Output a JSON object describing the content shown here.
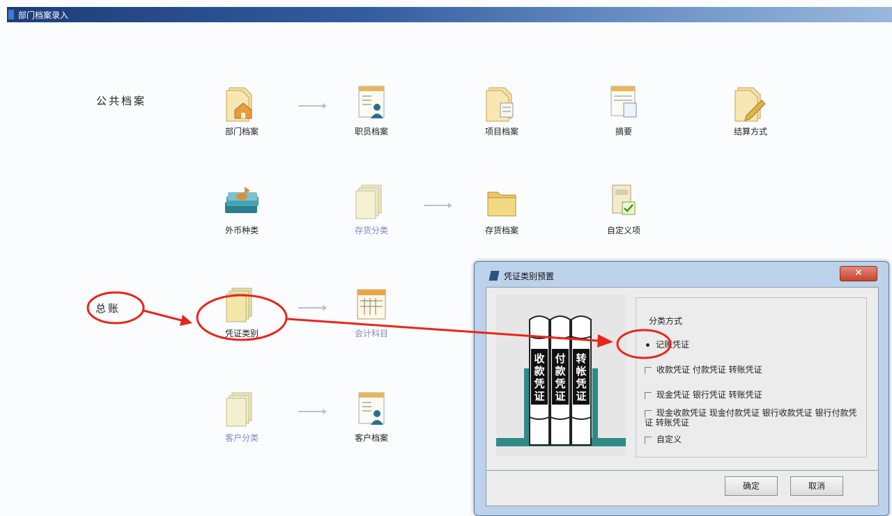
{
  "window": {
    "title": "部门档案录入"
  },
  "sections": {
    "public": "公共档案",
    "ledger": "总账"
  },
  "items": {
    "dept": "部门档案",
    "staff": "职员档案",
    "project": "项目档案",
    "summary": "摘要",
    "settlement": "结算方式",
    "currency": "外币种类",
    "inv_class": "存货分类",
    "inv_archive": "存货档案",
    "custom_item": "自定义项",
    "voucher_type": "凭证类别",
    "account": "会计科目",
    "cust_class": "客户分类",
    "cust_archive": "客户档案"
  },
  "dialog": {
    "title": "凭证类别预置",
    "close": "✕",
    "group_title": "分类方式",
    "options": [
      "记账凭证",
      "收款凭证 付款凭证 转账凭证",
      "现金凭证 银行凭证 转账凭证",
      "现金收款凭证 现金付款凭证 银行收款凭证 银行付款凭证 转账凭证",
      "自定义"
    ],
    "selected_index": 0,
    "ok": "确定",
    "cancel": "取消",
    "book_spines": [
      "收款凭证",
      "付款凭证",
      "转帐凭证"
    ]
  },
  "colors": {
    "annotation": "#e8251a",
    "titlebar": "#1d3d7a",
    "dialog_frame": "#bcd1ea"
  }
}
